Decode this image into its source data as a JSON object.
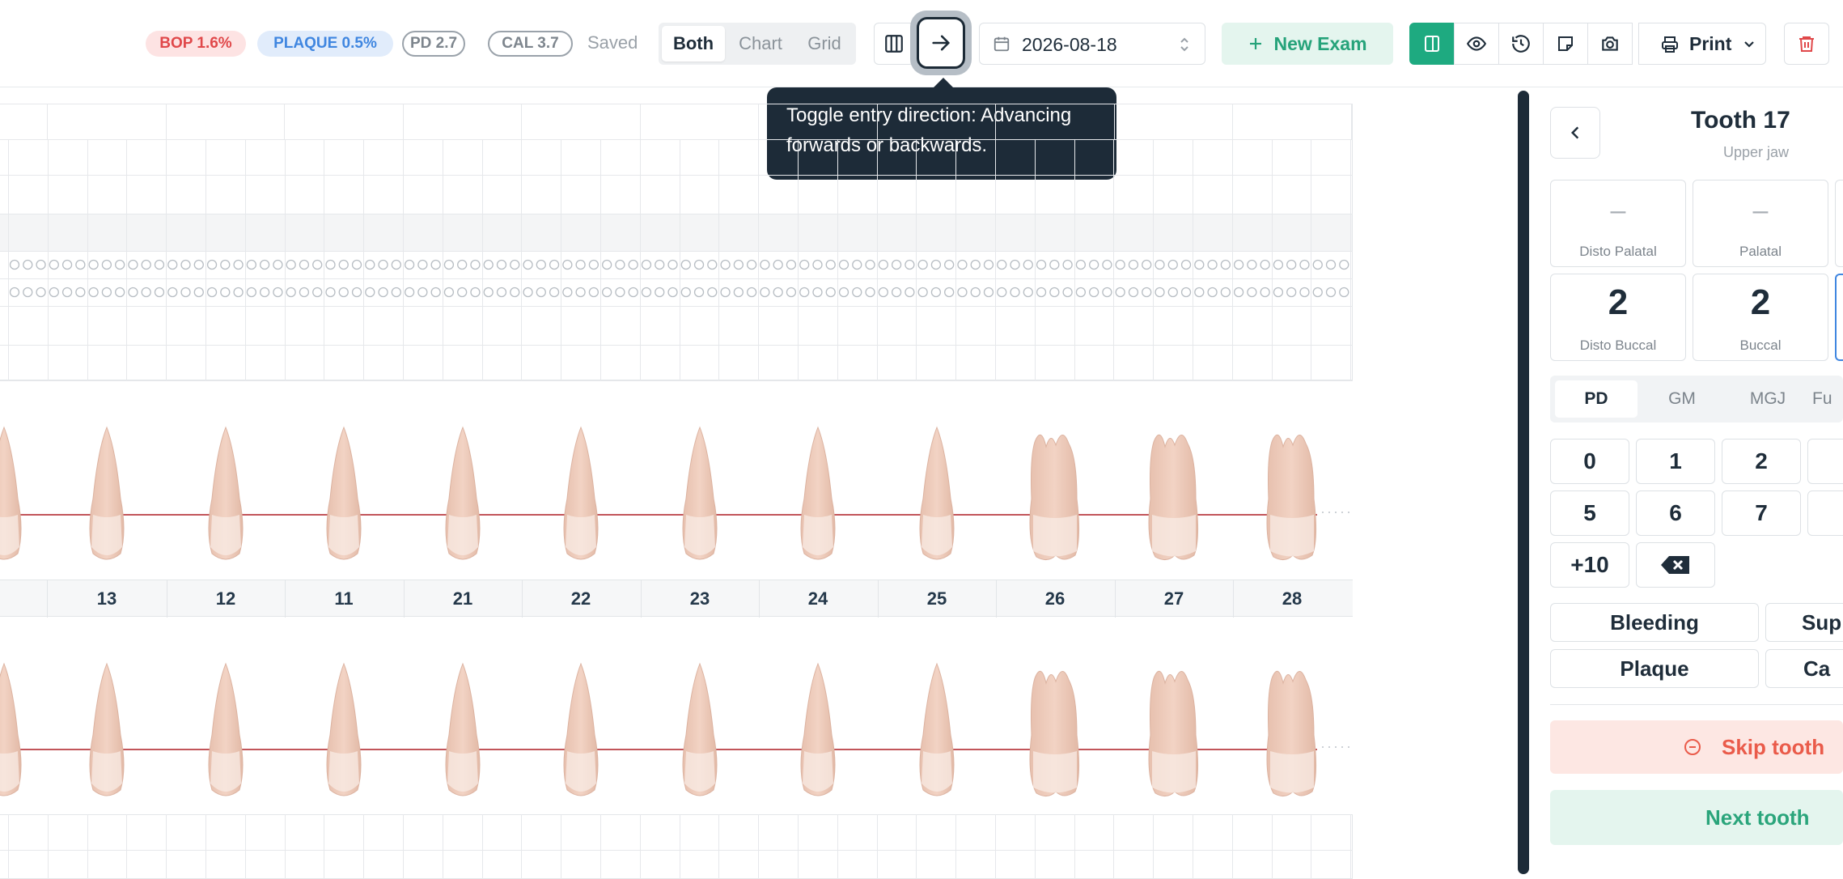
{
  "header": {
    "bop": "BOP 1.6%",
    "plaque": "PLAQUE 0.5%",
    "pd": "PD 2.7",
    "cal": "CAL 3.7",
    "status": "Saved",
    "view_modes": [
      "Both",
      "Chart",
      "Grid"
    ],
    "active_view_mode": "Both",
    "date": "2026-08-18",
    "new_exam": "New Exam",
    "print": "Print"
  },
  "tooltip": {
    "line1": "Toggle entry direction: Advancing",
    "line2": "forwards or backwards."
  },
  "chart": {
    "tooth_numbers": [
      "13",
      "12",
      "11",
      "21",
      "22",
      "23",
      "24",
      "25",
      "26",
      "27",
      "28"
    ],
    "colors": {
      "gumline": "#c2555a",
      "tooth": "#f2d3c4"
    }
  },
  "panel": {
    "title": "Tooth 17",
    "subtitle": "Upper jaw",
    "sites": [
      {
        "label": "Disto Palatal",
        "value": "–"
      },
      {
        "label": "Palatal",
        "value": "–"
      },
      {
        "label": "Disto Buccal",
        "value": "2"
      },
      {
        "label": "Buccal",
        "value": "2"
      }
    ],
    "tabs": [
      "PD",
      "GM",
      "MGJ",
      "Fu"
    ],
    "active_tab": "PD",
    "keys": [
      "0",
      "1",
      "2",
      "5",
      "6",
      "7",
      "+10"
    ],
    "bleeding": "Bleeding",
    "sup": "Sup",
    "plaque": "Plaque",
    "ca": "Ca",
    "skip": "Skip tooth",
    "next": "Next tooth"
  },
  "icons": {
    "columns": "columns-icon",
    "direction": "arrow-right-icon",
    "calendar": "calendar-icon",
    "plus": "plus-icon",
    "sidebar": "sidebar-panel-icon",
    "eye": "eye-icon",
    "history": "history-icon",
    "note": "sticky-note-icon",
    "camera": "camera-icon",
    "printer": "printer-icon",
    "trash": "trash-icon"
  }
}
